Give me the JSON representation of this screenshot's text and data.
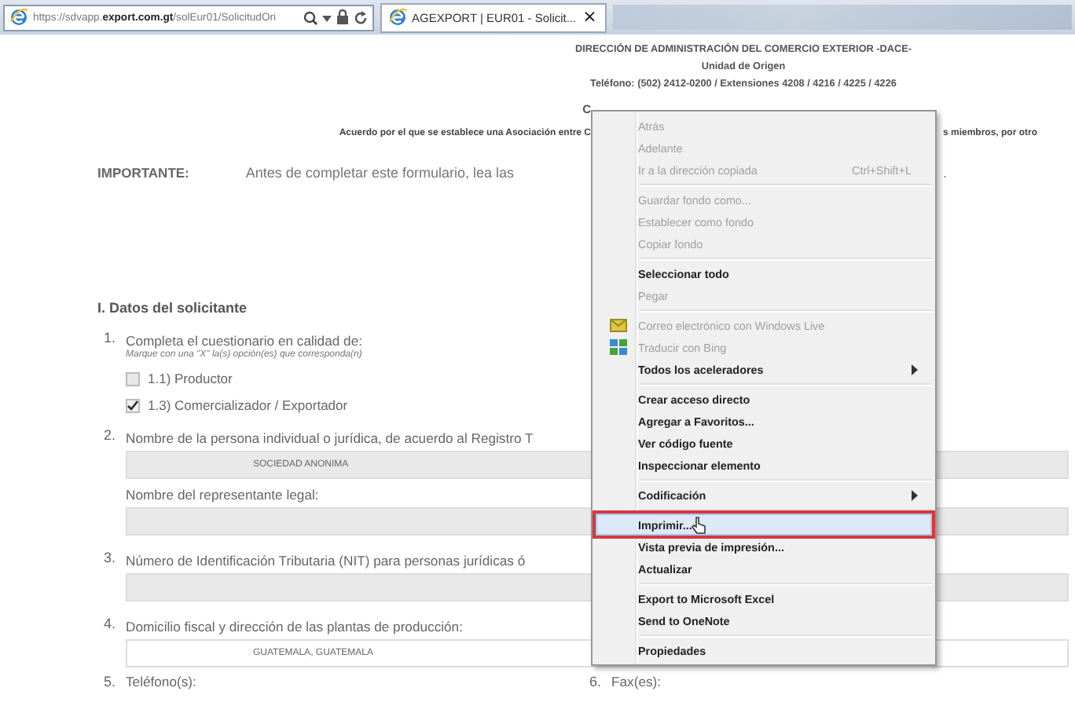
{
  "browser": {
    "address": "https://sdvapp.**export.com.gt**/solEur01/SolicitudOri",
    "tabs": [
      {
        "title": "AGEXPORT | EUR01 - Solicit...",
        "selected": true,
        "close": "×"
      }
    ]
  },
  "page": {
    "header": [
      "DIRECCIÓN DE ADMINISTRACIÓN DEL COMERCIO EXTERIOR -DACE-",
      "Unidad de Origen",
      "Teléfono: (502) 2412-0200 / Extensiones 4208 / 4216 / 4225 / 4226"
    ],
    "title_fragment": "C",
    "agreement": {
      "left": "Acuerdo por el que se establece una Asociación entre C",
      "right": "s miembros, por otro"
    },
    "important": {
      "label": "IMPORTANTE:",
      "left": "Antes de completar este formulario, lea las",
      "right": "."
    },
    "section_title": "I. Datos del solicitante",
    "questions": [
      {
        "number": "1.",
        "lines": [
          {
            "kind": "label",
            "text": "Completa el cuestionario en calidad de:"
          },
          {
            "kind": "hint",
            "text": "Marque con una \"X\" la(s) opción(es) que corresponda(n)"
          },
          {
            "kind": "option",
            "text": "1.1) Productor",
            "checked": false
          },
          {
            "kind": "option",
            "text": "1.3) Comercializador / Exportador",
            "checked": true
          }
        ]
      },
      {
        "number": "2.",
        "lines": [
          {
            "kind": "label",
            "text": "Nombre de la persona individual o jurídica, de acuerdo al Registro T"
          },
          {
            "kind": "field",
            "value": "SOCIEDAD ANONIMA",
            "disabled": true
          },
          {
            "kind": "label",
            "text": "Nombre del representante legal:"
          },
          {
            "kind": "field",
            "disabled": true
          }
        ]
      },
      {
        "number": "3.",
        "lines": [
          {
            "kind": "label",
            "text": "Número de Identificación Tributaria (NIT) para personas jurídicas ó"
          },
          {
            "kind": "field",
            "disabled": true
          }
        ]
      },
      {
        "number": "4.",
        "lines": [
          {
            "kind": "label",
            "text": "Domicilio fiscal y dirección de las plantas de producción:"
          },
          {
            "kind": "field",
            "value": "GUATEMALA, GUATEMALA",
            "disabled": false
          }
        ]
      }
    ],
    "bottom_row": [
      {
        "number": "5.",
        "label": "Teléfono(s):"
      },
      {
        "number": "6.",
        "label": "Fax(es):"
      }
    ]
  },
  "context_menu": {
    "items": [
      {
        "kind": "item",
        "label": "Atrás",
        "disabled": true,
        "selected": false,
        "annotated": false
      },
      {
        "kind": "item",
        "label": "Adelante",
        "disabled": true,
        "selected": false,
        "annotated": false
      },
      {
        "kind": "item",
        "label": "Ir a la dirección copiada",
        "shortcut": "Ctrl+Shift+L",
        "disabled": true,
        "selected": false,
        "annotated": false
      },
      {
        "kind": "separator"
      },
      {
        "kind": "item",
        "label": "Guardar fondo como...",
        "disabled": true,
        "selected": false,
        "annotated": false
      },
      {
        "kind": "item",
        "label": "Establecer como fondo",
        "disabled": true,
        "selected": false,
        "annotated": false
      },
      {
        "kind": "item",
        "label": "Copiar fondo",
        "disabled": true,
        "selected": false,
        "annotated": false
      },
      {
        "kind": "separator"
      },
      {
        "kind": "item",
        "label": "Seleccionar todo",
        "disabled": false,
        "selected": false,
        "annotated": false
      },
      {
        "kind": "item",
        "label": "Pegar",
        "disabled": true,
        "selected": false,
        "annotated": false
      },
      {
        "kind": "separator"
      },
      {
        "kind": "mail-item",
        "label": "Correo electrónico con Windows Live",
        "disabled": true,
        "selected": false,
        "annotated": false
      },
      {
        "kind": "translate-item",
        "label": "Traducir con Bing",
        "disabled": true,
        "selected": false,
        "annotated": false
      },
      {
        "kind": "item",
        "label": "Todos los aceleradores",
        "submenu": true,
        "disabled": false,
        "selected": false,
        "annotated": false
      },
      {
        "kind": "separator"
      },
      {
        "kind": "item",
        "label": "Crear acceso directo",
        "disabled": false,
        "selected": false,
        "annotated": false
      },
      {
        "kind": "item",
        "label": "Agregar a Favoritos...",
        "disabled": false,
        "selected": false,
        "annotated": false
      },
      {
        "kind": "item",
        "label": "Ver código fuente",
        "disabled": false,
        "selected": false,
        "annotated": false
      },
      {
        "kind": "item",
        "label": "Inspeccionar elemento",
        "disabled": false,
        "selected": false,
        "annotated": false
      },
      {
        "kind": "separator"
      },
      {
        "kind": "item",
        "label": "Codificación",
        "submenu": true,
        "disabled": false,
        "selected": false,
        "annotated": false
      },
      {
        "kind": "separator"
      },
      {
        "kind": "item",
        "label": "Imprimir...",
        "disabled": false,
        "selected": true,
        "annotated": true
      },
      {
        "kind": "item",
        "label": "Vista previa de impresión...",
        "disabled": false,
        "selected": false,
        "annotated": false
      },
      {
        "kind": "item",
        "label": "Actualizar",
        "disabled": false,
        "selected": false,
        "annotated": false
      },
      {
        "kind": "separator"
      },
      {
        "kind": "item",
        "label": "Export to Microsoft Excel",
        "disabled": false,
        "selected": false,
        "annotated": false
      },
      {
        "kind": "item",
        "label": "Send to OneNote",
        "disabled": false,
        "selected": false,
        "annotated": false
      },
      {
        "kind": "separator"
      },
      {
        "kind": "item",
        "label": "Propiedades",
        "disabled": false,
        "selected": false,
        "annotated": false
      }
    ]
  }
}
